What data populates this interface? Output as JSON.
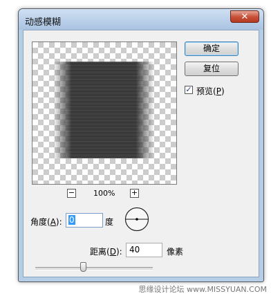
{
  "window": {
    "title": "动感模糊",
    "close_symbol": "✕"
  },
  "preview": {
    "zoom_minus": "−",
    "zoom_plus": "+",
    "zoom_level": "100%"
  },
  "buttons": {
    "ok_label": "确定",
    "reset_label": "复位"
  },
  "preview_toggle": {
    "label_prefix": "预览(",
    "hotkey": "P",
    "label_suffix": ")",
    "checked": true,
    "check_mark": "✓"
  },
  "angle": {
    "label_prefix": "角度(",
    "hotkey": "A",
    "label_suffix": "):",
    "value": "0",
    "unit": "度"
  },
  "distance": {
    "label_prefix": "距离(",
    "hotkey": "D",
    "label_suffix": "):",
    "value": "40",
    "unit": "像素"
  },
  "slider": {
    "fraction": 0.41
  },
  "watermark": {
    "text": "思缘设计论坛 www.MISSYUAN.COM"
  }
}
